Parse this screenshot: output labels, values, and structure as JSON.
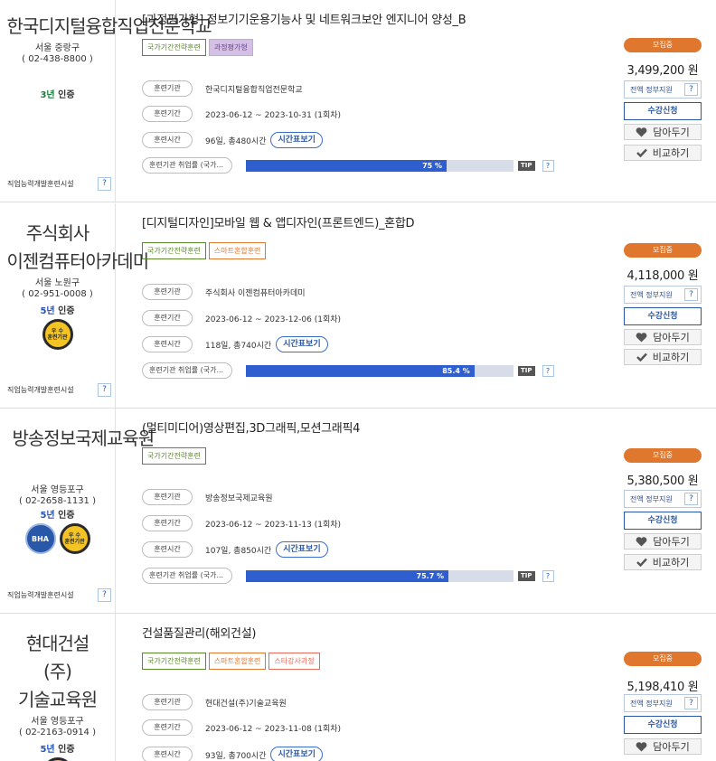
{
  "labels": {
    "org": "훈련기관",
    "period": "훈련기간",
    "hours": "훈련시간",
    "employment": "훈련기관 취업률 (국가...",
    "timetable": "시간표보기",
    "tip": "TIP",
    "question": "?",
    "status": "모집중",
    "support": "전액 정부지원",
    "apply": "수강신청",
    "wishlist": "담아두기",
    "compare": "비교하기",
    "vocational": "직업능력개발훈련시설"
  },
  "accent_colors": {
    "status": "#e0772e",
    "bar_fill": "#2f5fcf",
    "bar_track": "#d6dde9",
    "link_blue": "#2a58a8"
  },
  "icons": [
    "heart-icon",
    "check-icon",
    "question-icon",
    "gold-cert-badge",
    "bha-badge"
  ],
  "courses": [
    {
      "institution": "한국디지털융합직업전문학교",
      "location": "서울 중랑구",
      "phone": "( 02-438-8800 )",
      "cert_years": "3년",
      "cert_suffix": " 인증",
      "title": "[과정평가형] 정보기기운용기능사 및 네트워크보안 엔지니어 양성_B",
      "tags": [
        "국가기간전략훈련",
        "과정평가형"
      ],
      "org_name": "한국디지털융합직업전문학교",
      "period": "2023-06-12 ~ 2023-10-31 (1회차)",
      "hours": "96일, 총480시간",
      "employment_rate_text": "75 %",
      "employment_rate": 75,
      "price": "3,499,200 원"
    },
    {
      "institution": "주식회사 이젠컴퓨터아카데미",
      "location": "서울 노원구",
      "phone": "( 02-951-0008 )",
      "cert_years": "5년",
      "cert_suffix": " 인증",
      "title": "[디지털디자인]모바일 웹 & 앱디자인(프론트엔드)_혼합D",
      "tags": [
        "국가기간전략훈련",
        "스마트혼합훈련"
      ],
      "org_name": "주식회사 이젠컴퓨터아카데미",
      "period": "2023-06-12 ~ 2023-12-06 (1회차)",
      "hours": "118일, 총740시간",
      "employment_rate_text": "85.4 %",
      "employment_rate": 85.4,
      "price": "4,118,000 원",
      "badge_text": [
        "우 수",
        "훈련기관"
      ]
    },
    {
      "institution": "방송정보국제교육원",
      "location": "서울 영등포구",
      "phone": "( 02-2658-1131 )",
      "cert_years": "5년",
      "cert_suffix": " 인증",
      "title": "(멀티미디어)영상편집,3D그래픽,모션그래픽4",
      "tags": [
        "국가기간전략훈련"
      ],
      "org_name": "방송정보국제교육원",
      "period": "2023-06-12 ~ 2023-11-13 (1회차)",
      "hours": "107일, 총850시간",
      "employment_rate_text": "75.7 %",
      "employment_rate": 75.7,
      "price": "5,380,500 원",
      "badge_text": [
        "우 수",
        "훈련기관"
      ],
      "bha_text": "BHA"
    },
    {
      "institution": "현대건설(주)기술교육원",
      "location": "서울 영등포구",
      "phone": "( 02-2163-0914 )",
      "cert_years": "5년",
      "cert_suffix": " 인증",
      "title": "건설품질관리(해외건설)",
      "tags": [
        "국가기간전략훈련",
        "스마트혼합훈련",
        "스타강사과정"
      ],
      "org_name": "현대건설(주)기술교육원",
      "period": "2023-06-12 ~ 2023-11-08 (1회차)",
      "hours": "93일, 총700시간",
      "price": "5,198,410 원"
    }
  ]
}
